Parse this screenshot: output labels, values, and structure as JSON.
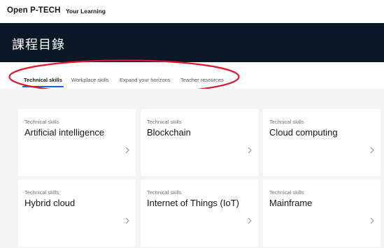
{
  "header": {
    "brand": "Open P-TECH",
    "section": "Your Learning"
  },
  "hero": {
    "title": "課程目錄"
  },
  "tabs": [
    {
      "label": "Technical skills",
      "active": true
    },
    {
      "label": "Workplace skills",
      "active": false
    },
    {
      "label": "Expand your horizons",
      "active": false
    },
    {
      "label": "Teacher resources",
      "active": false
    }
  ],
  "cards": [
    {
      "category": "Technical skills",
      "title": "Artificial intelligence"
    },
    {
      "category": "Technical skills",
      "title": "Blockchain"
    },
    {
      "category": "Technical skills",
      "title": "Cloud computing"
    },
    {
      "category": "Technical skills",
      "title": "Hybrid cloud"
    },
    {
      "category": "Technical skills",
      "title": "Internet of Things (IoT)"
    },
    {
      "category": "Technical skills",
      "title": "Mainframe"
    }
  ],
  "colors": {
    "hero_bg": "#0b1826",
    "accent": "#0f62fe",
    "annotation": "#e0182d"
  }
}
